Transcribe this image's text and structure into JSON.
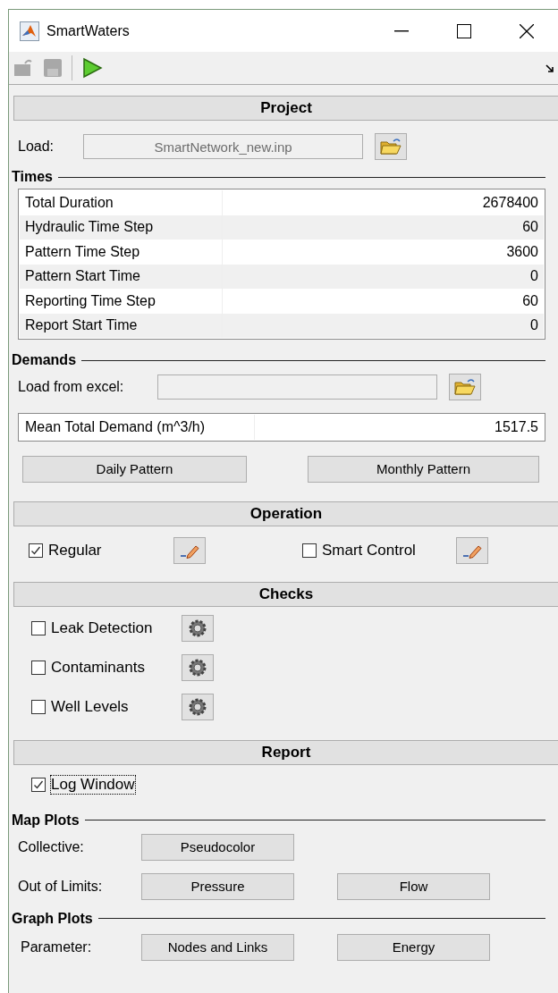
{
  "window": {
    "title": "SmartWaters"
  },
  "toolbar": {
    "buttons": [
      {
        "kind": "open",
        "disabled": true
      },
      {
        "kind": "save",
        "disabled": true
      },
      {
        "kind": "run",
        "disabled": false
      }
    ]
  },
  "project": {
    "heading": "Project",
    "load_label": "Load:",
    "file_value": "SmartNetwork_new.inp"
  },
  "times": {
    "heading": "Times",
    "rows": [
      {
        "label": "Total Duration",
        "value": "2678400"
      },
      {
        "label": "Hydraulic Time Step",
        "value": "60"
      },
      {
        "label": "Pattern Time Step",
        "value": "3600"
      },
      {
        "label": "Pattern Start Time",
        "value": "0"
      },
      {
        "label": "Reporting Time Step",
        "value": "60"
      },
      {
        "label": "Report Start Time",
        "value": "0"
      }
    ]
  },
  "demands": {
    "heading": "Demands",
    "excel_label": "Load from excel:",
    "mean_label": "Mean Total Demand (m^3/h)",
    "mean_value": "1517.5",
    "buttons": [
      "Daily Pattern",
      "Monthly Pattern"
    ]
  },
  "operation": {
    "heading": "Operation",
    "options": [
      {
        "label": "Regular",
        "checked": true
      },
      {
        "label": "Smart Control",
        "checked": false
      }
    ]
  },
  "checks": {
    "heading": "Checks",
    "items": [
      {
        "label": "Leak Detection",
        "checked": false
      },
      {
        "label": "Contaminants",
        "checked": false
      },
      {
        "label": "Well Levels",
        "checked": false
      }
    ]
  },
  "report": {
    "heading": "Report",
    "items": [
      {
        "label": "Log Window",
        "checked": true,
        "focused": true
      }
    ]
  },
  "map_plots": {
    "heading": "Map Plots",
    "rows": [
      {
        "label": "Collective:",
        "buttons": [
          "Pseudocolor"
        ]
      },
      {
        "label": "Out of Limits:",
        "buttons": [
          "Pressure",
          "Flow"
        ]
      }
    ]
  },
  "graph_plots": {
    "heading": "Graph Plots",
    "rows": [
      {
        "label": "Parameter:",
        "buttons": [
          "Nodes and Links",
          "Energy"
        ]
      }
    ]
  }
}
